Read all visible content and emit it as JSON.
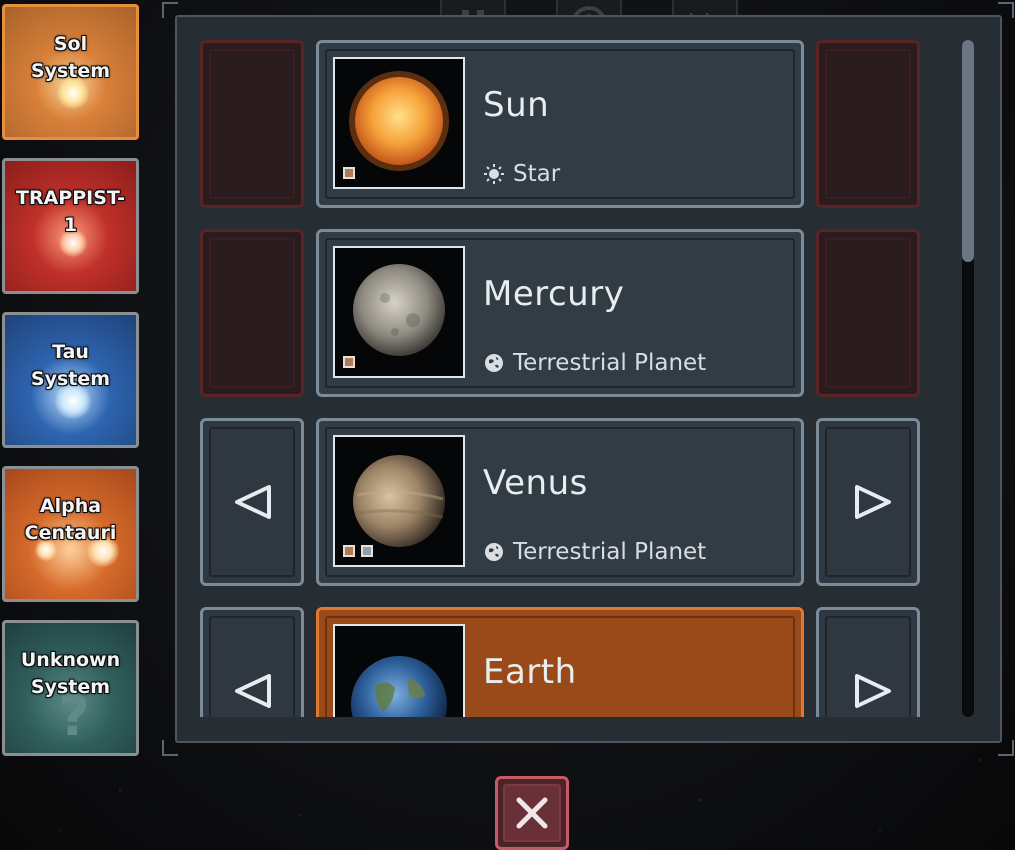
{
  "systems": [
    {
      "label": "Sol\nSystem",
      "color": "#d9803a",
      "selected": true
    },
    {
      "label": "TRAPPIST-\n1",
      "color": "#c0302a"
    },
    {
      "label": "Tau\nSystem",
      "color": "#2e64b0"
    },
    {
      "label": "Alpha\nCentauri",
      "color": "#d56a2a"
    },
    {
      "label": "Unknown\nSystem",
      "color": "#2f5e5c"
    }
  ],
  "bodies": [
    {
      "name": "Sun",
      "type": "Star",
      "type_icon": "star-icon"
    },
    {
      "name": "Mercury",
      "type": "Terrestrial Planet",
      "type_icon": "planet-type-icon"
    },
    {
      "name": "Venus",
      "type": "Terrestrial Planet",
      "type_icon": "planet-type-icon"
    },
    {
      "name": "Earth",
      "type": "",
      "selected": true
    }
  ],
  "colors": {
    "accent": "#e07830",
    "panel": "#262d33",
    "close": "#c65a66"
  },
  "icons": {
    "prev": "chevron-left-icon",
    "next": "chevron-right-icon",
    "close": "close-icon"
  }
}
